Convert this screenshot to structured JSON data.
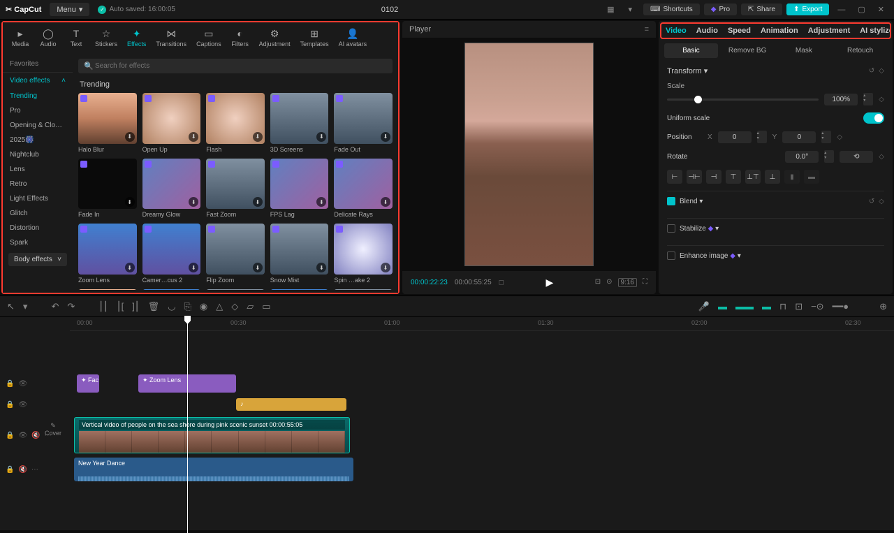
{
  "topbar": {
    "logo": "✂ CapCut",
    "menu": "Menu",
    "autosave": "Auto saved: 16:00:05",
    "project": "0102",
    "shortcuts": "Shortcuts",
    "pro": "Pro",
    "share": "Share",
    "export": "Export"
  },
  "tools": [
    {
      "label": "Media",
      "icon": "▸"
    },
    {
      "label": "Audio",
      "icon": "◯"
    },
    {
      "label": "Text",
      "icon": "T"
    },
    {
      "label": "Stickers",
      "icon": "☆"
    },
    {
      "label": "Effects",
      "icon": "✦",
      "active": true
    },
    {
      "label": "Transitions",
      "icon": "⋈"
    },
    {
      "label": "Captions",
      "icon": "▭"
    },
    {
      "label": "Filters",
      "icon": "◐"
    },
    {
      "label": "Adjustment",
      "icon": "⚙"
    },
    {
      "label": "Templates",
      "icon": "⊞"
    },
    {
      "label": "AI avatars",
      "icon": "👤"
    }
  ],
  "sidebar": {
    "favorites": "Favorites",
    "video_effects": "Video effects",
    "cats": [
      "Trending",
      "Pro",
      "Opening & Clos…",
      "2025🎆",
      "Nightclub",
      "Lens",
      "Retro",
      "Light Effects",
      "Glitch",
      "Distortion",
      "Spark"
    ],
    "body_effects": "Body effects"
  },
  "search": {
    "placeholder": "Search for effects"
  },
  "trending_label": "Trending",
  "effects": [
    {
      "name": "Halo Blur",
      "cls": "th-sunset"
    },
    {
      "name": "Open Up",
      "cls": "th-blur"
    },
    {
      "name": "Flash",
      "cls": "th-blur"
    },
    {
      "name": "3D Screens",
      "cls": "th-city"
    },
    {
      "name": "Fade Out",
      "cls": "th-city"
    },
    {
      "name": "Fade In",
      "cls": "th-dark"
    },
    {
      "name": "Dreamy Glow",
      "cls": "th-portrait"
    },
    {
      "name": "Fast Zoom",
      "cls": "th-city"
    },
    {
      "name": "FPS Lag",
      "cls": "th-portrait"
    },
    {
      "name": "Delicate Rays",
      "cls": "th-portrait"
    },
    {
      "name": "Zoom Lens",
      "cls": "th-blue"
    },
    {
      "name": "Camer…cus 2",
      "cls": "th-blue"
    },
    {
      "name": "Flip Zoom",
      "cls": "th-city"
    },
    {
      "name": "Snow Mist",
      "cls": "th-city"
    },
    {
      "name": "Spin …ake 2",
      "cls": "th-spiral"
    },
    {
      "name": "",
      "cls": "th-sunset"
    },
    {
      "name": "",
      "cls": "th-blue"
    },
    {
      "name": "",
      "cls": "th-city"
    },
    {
      "name": "",
      "cls": "th-blue"
    },
    {
      "name": "",
      "cls": "th-city"
    }
  ],
  "player": {
    "title": "Player",
    "cur": "00:00:22:23",
    "dur": "00:00:55:25"
  },
  "rtabs": [
    "Video",
    "Audio",
    "Speed",
    "Animation",
    "Adjustment",
    "AI stylize"
  ],
  "subtabs": [
    "Basic",
    "Remove BG",
    "Mask",
    "Retouch"
  ],
  "props": {
    "transform": "Transform",
    "scale_label": "Scale",
    "scale_val": "100%",
    "uniform": "Uniform scale",
    "position": "Position",
    "pos_x_label": "X",
    "pos_x": "0",
    "pos_y_label": "Y",
    "pos_y": "0",
    "rotate": "Rotate",
    "rotate_val": "0.0°",
    "blend": "Blend",
    "stabilize": "Stabilize",
    "enhance": "Enhance image"
  },
  "ruler": [
    "00:00",
    "00:30",
    "01:00",
    "01:30",
    "02:00",
    "02:30"
  ],
  "clips": {
    "fx1": "✦ Fac",
    "fx2": "✦ Zoom Lens",
    "video_title": "Vertical video of people on the sea shore during pink scenic sunset   00:00:55:05",
    "audio": "New Year Dance",
    "cover": "Cover"
  }
}
